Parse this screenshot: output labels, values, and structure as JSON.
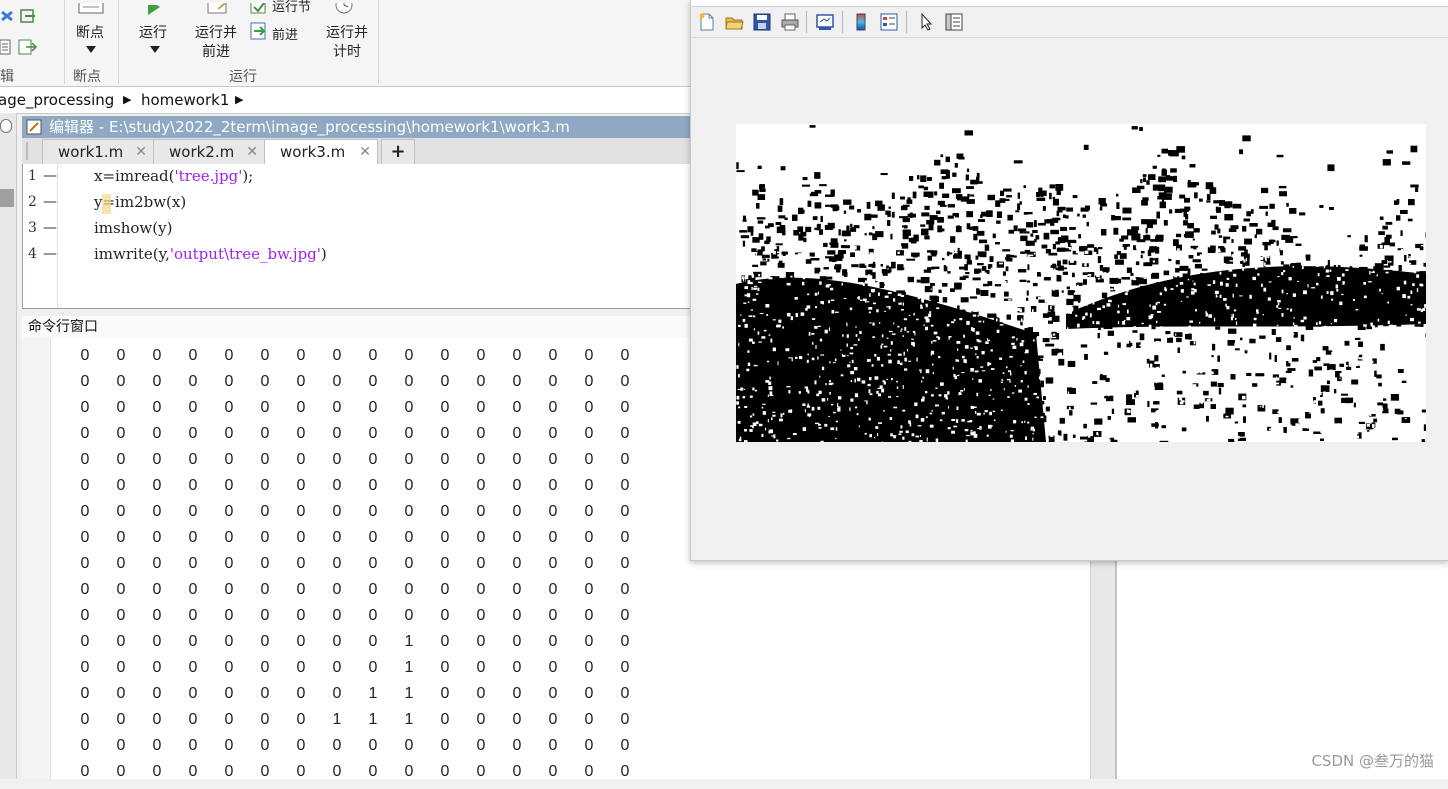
{
  "ribbon": {
    "breakpoint_label": "断点",
    "breakpoint_group": "断点",
    "run_label": "运行",
    "run_advance_line1": "运行并",
    "run_advance_line2": "前进",
    "run_section_label": "运行节",
    "advance_label": "前进",
    "run_time_line1": "运行并",
    "run_time_line2": "计时",
    "run_group": "运行",
    "edit_group_partial": "辑"
  },
  "address": {
    "segments": [
      "age_processing",
      "homework1"
    ]
  },
  "editor": {
    "title": "编辑器 - E:\\study\\2022_2term\\image_processing\\homework1\\work3.m",
    "tabs": [
      {
        "label": "work1.m",
        "close": "✕"
      },
      {
        "label": "work2.m",
        "close": "✕"
      },
      {
        "label": "work3.m",
        "close": "✕"
      }
    ],
    "add_tab": "+",
    "lines": [
      {
        "num": "1",
        "dash": "—",
        "pre": "x=imread(",
        "str": "'tree.jpg'",
        "post": ");"
      },
      {
        "num": "2",
        "dash": "—",
        "pre": "y=im2bw(x)",
        "str": "",
        "post": ""
      },
      {
        "num": "3",
        "dash": "—",
        "pre": "imshow(y)",
        "str": "",
        "post": ""
      },
      {
        "num": "4",
        "dash": "—",
        "pre": "imwrite(y,",
        "str": "'output\\tree_bw.jpg'",
        "post": ")"
      }
    ]
  },
  "command_window": {
    "title": "命令行窗口",
    "matrix": [
      [
        0,
        0,
        0,
        0,
        0,
        0,
        0,
        0,
        0,
        0,
        0,
        0,
        0,
        0,
        0,
        0
      ],
      [
        0,
        0,
        0,
        0,
        0,
        0,
        0,
        0,
        0,
        0,
        0,
        0,
        0,
        0,
        0,
        0
      ],
      [
        0,
        0,
        0,
        0,
        0,
        0,
        0,
        0,
        0,
        0,
        0,
        0,
        0,
        0,
        0,
        0
      ],
      [
        0,
        0,
        0,
        0,
        0,
        0,
        0,
        0,
        0,
        0,
        0,
        0,
        0,
        0,
        0,
        0
      ],
      [
        0,
        0,
        0,
        0,
        0,
        0,
        0,
        0,
        0,
        0,
        0,
        0,
        0,
        0,
        0,
        0
      ],
      [
        0,
        0,
        0,
        0,
        0,
        0,
        0,
        0,
        0,
        0,
        0,
        0,
        0,
        0,
        0,
        0
      ],
      [
        0,
        0,
        0,
        0,
        0,
        0,
        0,
        0,
        0,
        0,
        0,
        0,
        0,
        0,
        0,
        0
      ],
      [
        0,
        0,
        0,
        0,
        0,
        0,
        0,
        0,
        0,
        0,
        0,
        0,
        0,
        0,
        0,
        0
      ],
      [
        0,
        0,
        0,
        0,
        0,
        0,
        0,
        0,
        0,
        0,
        0,
        0,
        0,
        0,
        0,
        0
      ],
      [
        0,
        0,
        0,
        0,
        0,
        0,
        0,
        0,
        0,
        0,
        0,
        0,
        0,
        0,
        0,
        0
      ],
      [
        0,
        0,
        0,
        0,
        0,
        0,
        0,
        0,
        0,
        0,
        0,
        0,
        0,
        0,
        0,
        0
      ],
      [
        0,
        0,
        0,
        0,
        0,
        0,
        0,
        0,
        0,
        1,
        0,
        0,
        0,
        0,
        0,
        0
      ],
      [
        0,
        0,
        0,
        0,
        0,
        0,
        0,
        0,
        0,
        1,
        0,
        0,
        0,
        0,
        0,
        0
      ],
      [
        0,
        0,
        0,
        0,
        0,
        0,
        0,
        0,
        1,
        1,
        0,
        0,
        0,
        0,
        0,
        0
      ],
      [
        0,
        0,
        0,
        0,
        0,
        0,
        0,
        1,
        1,
        1,
        0,
        0,
        0,
        0,
        0,
        0
      ],
      [
        0,
        0,
        0,
        0,
        0,
        0,
        0,
        0,
        0,
        0,
        0,
        0,
        0,
        0,
        0,
        0
      ],
      [
        0,
        0,
        0,
        0,
        0,
        0,
        0,
        0,
        0,
        0,
        0,
        0,
        0,
        0,
        0,
        0
      ]
    ]
  },
  "figure": {
    "toolbar_icons": [
      "new-figure-icon",
      "open-file-icon",
      "save-icon",
      "print-icon",
      "link-plot-icon",
      "colorbar-icon",
      "legend-icon",
      "pointer-icon",
      "property-editor-icon"
    ],
    "image_caption": "im2bw output of tree.jpg"
  },
  "watermark": "CSDN @叁万的猫"
}
